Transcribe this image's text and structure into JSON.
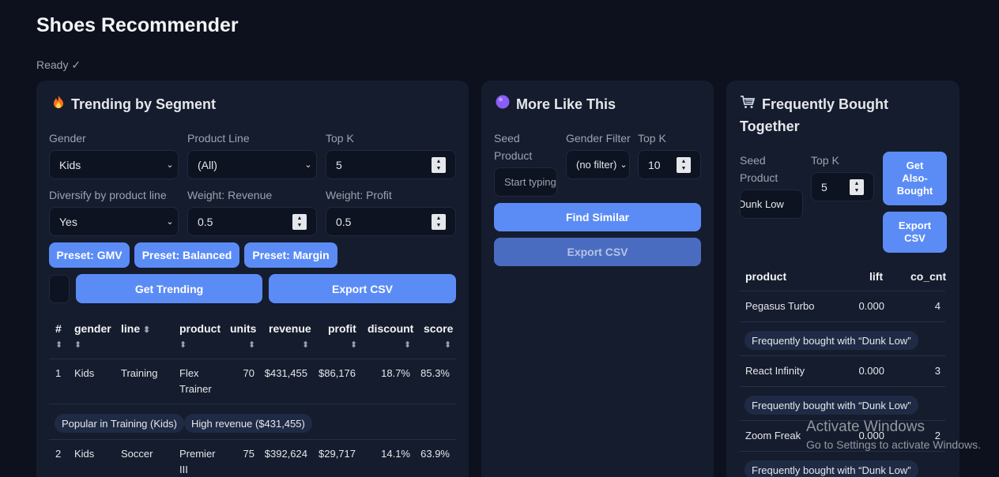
{
  "app": {
    "title": "Shoes Recommender",
    "status": "Ready ✓"
  },
  "trending": {
    "title": "Trending by Segment",
    "icon": "fire-icon",
    "gender_label": "Gender",
    "gender_value": "Kids",
    "line_label": "Product Line",
    "line_value": "(All)",
    "topk_label": "Top K",
    "topk_value": "5",
    "diversify_label": "Diversify by product line",
    "diversify_value": "Yes",
    "wrev_label": "Weight: Revenue",
    "wrev_value": "0.5",
    "wprofit_label": "Weight: Profit",
    "wprofit_value": "0.5",
    "presets": [
      "Preset: GMV",
      "Preset: Balanced",
      "Preset: Margin"
    ],
    "get_label": "Get Trending",
    "export_label": "Export CSV",
    "columns": [
      "#",
      "gender",
      "line",
      "product",
      "units",
      "revenue",
      "profit",
      "discount",
      "score"
    ],
    "rows": [
      {
        "rank": "1",
        "gender": "Kids",
        "line": "Training",
        "product_a": "Flex",
        "product_b": "Trainer",
        "units": "70",
        "revenue": "$431,455",
        "profit": "$86,176",
        "discount": "18.7%",
        "score": "85.3%",
        "tags": [
          "Popular in Training (Kids)",
          "High revenue ($431,455)"
        ]
      },
      {
        "rank": "2",
        "gender": "Kids",
        "line": "Soccer",
        "product_a": "Premier",
        "product_b": "III",
        "units": "75",
        "revenue": "$392,624",
        "profit": "$29,717",
        "discount": "14.1%",
        "score": "63.9%"
      }
    ]
  },
  "similar": {
    "title": "More Like This",
    "icon": "purple-circle-icon",
    "seed_label_a": "Seed",
    "seed_label_b": "Product",
    "seed_placeholder": "Start typing",
    "gender_label": "Gender Filter",
    "gender_value": "(no filter)",
    "topk_label": "Top K",
    "topk_value": "10",
    "find_label": "Find Similar",
    "export_label": "Export CSV"
  },
  "also": {
    "title_a": "Frequently Bought",
    "title_b": "Together",
    "icon": "shopping-cart-icon",
    "seed_label_a": "Seed",
    "seed_label_b": "Product",
    "seed_value": "Dunk Low",
    "topk_label": "Top K",
    "topk_value": "5",
    "get_label_a": "Get",
    "get_label_b": "Also-",
    "get_label_c": "Bought",
    "export_label_a": "Export",
    "export_label_b": "CSV",
    "columns": [
      "product",
      "lift",
      "co_cnt"
    ],
    "rows": [
      {
        "product": "Pegasus Turbo",
        "lift": "0.000",
        "co_cnt": "4",
        "tag": "Frequently bought with “Dunk Low”"
      },
      {
        "product": "React Infinity",
        "lift": "0.000",
        "co_cnt": "3",
        "tag": "Frequently bought with “Dunk Low”"
      },
      {
        "product": "Zoom Freak",
        "lift": "0.000",
        "co_cnt": "2",
        "tag": "Frequently bought with “Dunk Low”"
      }
    ]
  },
  "watermark": {
    "line1": "Activate Windows",
    "line2": "Go to Settings to activate Windows."
  }
}
